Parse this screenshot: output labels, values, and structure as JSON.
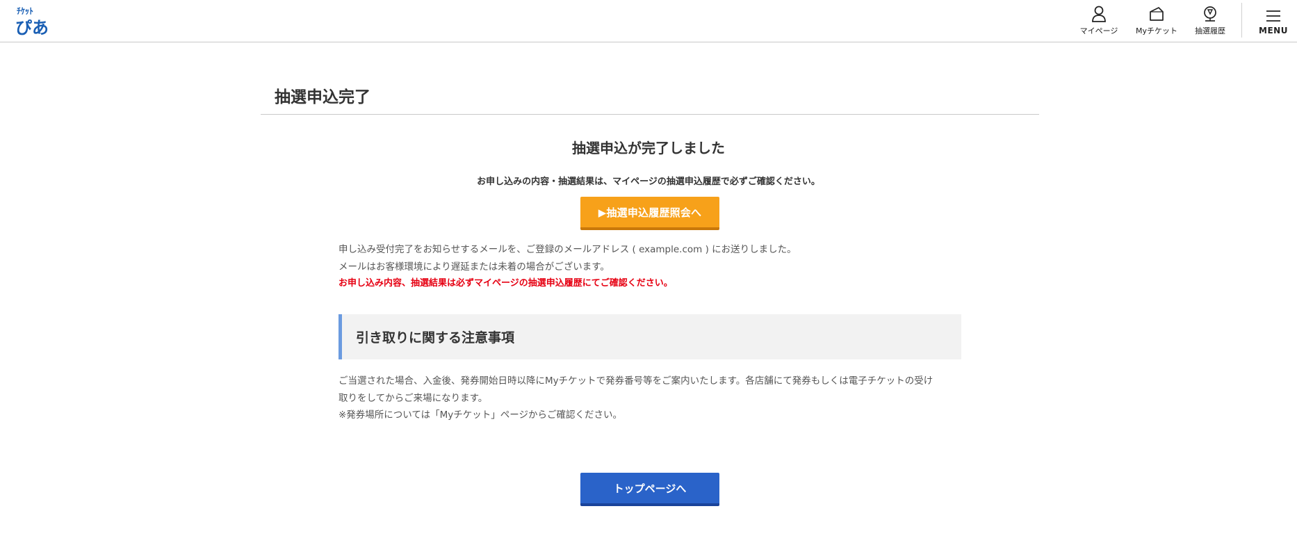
{
  "header": {
    "logo_text": "チケットぴあ",
    "nav": {
      "mypage_label": "マイページ",
      "myticket_label": "Myチケット",
      "lottery_history_label": "抽選履歴",
      "menu_label": "MENU"
    }
  },
  "page": {
    "title": "抽選申込完了",
    "complete_heading": "抽選申込が完了しました",
    "confirm_note": "お申し込みの内容・抽選結果は、マイページの抽選申込履歴で必ずご確認ください。",
    "history_button_label": "▶抽選申込履歴照会へ",
    "email_sent_text": "申し込み受付完了をお知らせするメールを、ご登録のメールアドレス ( example.com ) にお送りしました。",
    "email_delay_text": "メールはお客様環境により遅延または未着の場合がございます。",
    "warning_text": "お申し込み内容、抽選結果は必ずマイページの抽選申込履歴にてご確認ください。",
    "notice": {
      "title": "引き取りに関する注意事項",
      "text_line1": "ご当選された場合、入金後、発券開始日時以降にMyチケットで発券番号等をご案内いたします。各店舗にて発券もしくは電子チケットの受け",
      "text_line2": "取りをしてからご来場になります。",
      "text_line3": "※発券場所については「Myチケット」ページからご確認ください。"
    },
    "top_button_label": "トップページへ"
  },
  "colors": {
    "orange_button": "#f7a11a",
    "blue_button": "#2a63c9",
    "warning_red": "#e60012",
    "notice_accent": "#6b9be0",
    "logo_blue": "#1a5fb4"
  },
  "icons": {
    "mypage": "person-icon",
    "myticket": "ticket-icon",
    "lottery_history": "lottery-icon",
    "menu": "hamburger-icon"
  }
}
